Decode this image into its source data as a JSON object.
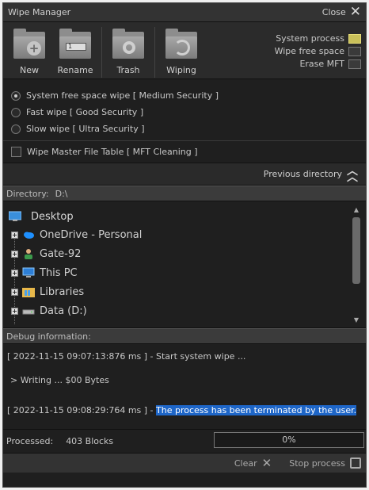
{
  "titlebar": {
    "title": "Wipe Manager",
    "close_label": "Close"
  },
  "toolbar": {
    "buttons": [
      {
        "label": "New",
        "icon": "new-folder-icon"
      },
      {
        "label": "Rename",
        "icon": "rename-folder-icon"
      },
      {
        "label": "Trash",
        "icon": "trash-folder-icon"
      },
      {
        "label": "Wiping",
        "icon": "wiping-folder-icon"
      }
    ],
    "rename_box_text": "1",
    "status_options": [
      {
        "label": "System process",
        "active": true
      },
      {
        "label": "Wipe free space",
        "active": false
      },
      {
        "label": "Erase MFT",
        "active": false
      }
    ]
  },
  "wipe_modes": [
    {
      "label": "System free space wipe [ Medium Security ]",
      "selected": true
    },
    {
      "label": "Fast wipe [ Good Security ]",
      "selected": false
    },
    {
      "label": "Slow wipe [ Ultra Security ]",
      "selected": false
    }
  ],
  "mft_option": {
    "label": "Wipe Master File Table [ MFT Cleaning ]",
    "checked": false
  },
  "previous_directory_label": "Previous directory",
  "directory": {
    "label": "Directory:",
    "value": "D:\\"
  },
  "tree": {
    "root": "Desktop",
    "items": [
      "OneDrive - Personal",
      "Gate-92",
      "This PC",
      "Libraries",
      "Data (D:)"
    ]
  },
  "debug": {
    "header": "Debug information:",
    "line1": "[ 2022-11-15  09:07:13:876 ms ] - Start system wipe ...",
    "line2": "> Writing ... $00 Bytes",
    "line3_prefix": "[ 2022-11-15  09:08:29:764 ms ] - ",
    "line3_selected": "The process has been terminated by the user."
  },
  "status": {
    "processed_label": "Processed:",
    "processed_value": "403 Blocks",
    "progress_text": "0%"
  },
  "bottom": {
    "clear_label": "Clear",
    "stop_label": "Stop process"
  },
  "colors": {
    "indicator_on": "#c9c05a",
    "selection": "#1e66c8",
    "background": "#1f1f1f"
  }
}
